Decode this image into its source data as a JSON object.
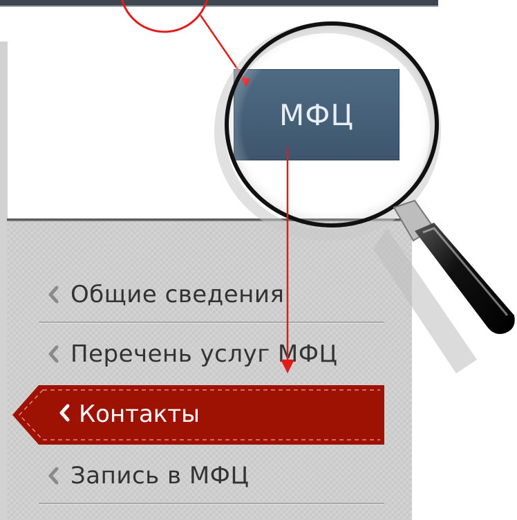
{
  "magnified_button": {
    "label": "МФЦ"
  },
  "menu": {
    "items": [
      {
        "label": "Общие сведения",
        "active": false
      },
      {
        "label": "Перечень услуг МФЦ",
        "active": false
      },
      {
        "label": "Контакты",
        "active": true
      },
      {
        "label": "Запись в МФЦ",
        "active": false
      }
    ]
  },
  "colors": {
    "active_bg": "#9e1204",
    "button_bg": "#4a657e",
    "annotation": "#e11a1a",
    "sidebar_bg": "#cfcfcf"
  }
}
